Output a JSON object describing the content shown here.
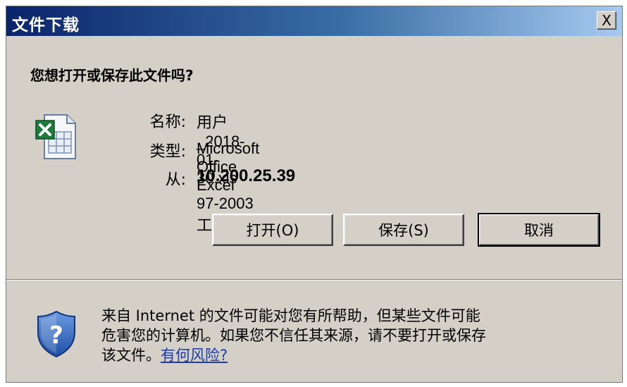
{
  "dialog": {
    "title": "文件下载",
    "close_label": "X",
    "question": "您想打开或保存此文件吗?",
    "file": {
      "name_label": "名称:",
      "name_value": "用户_2018-01-30.xls",
      "type_label": "类型:",
      "type_value": "Microsoft Office Excel 97-2003 工作表",
      "from_label": "从:",
      "from_value": "10.200.25.39"
    },
    "buttons": {
      "open": "打开(O)",
      "save": "保存(S)",
      "cancel": "取消"
    },
    "warning": {
      "line1": "来自 Internet 的文件可能对您有所帮助，但某些文件可能",
      "line2": "危害您的计算机。如果您不信任其来源，请不要打开或保存",
      "line3_prefix": "该文件。",
      "link": "有何风险?"
    }
  },
  "icons": {
    "file_icon": "excel-file-icon",
    "shield_icon": "shield-question-icon"
  },
  "colors": {
    "titlebar_start": "#0a246a",
    "titlebar_end": "#a6caf0",
    "dialog_bg": "#d4d0c8",
    "link": "#1a3da8"
  }
}
